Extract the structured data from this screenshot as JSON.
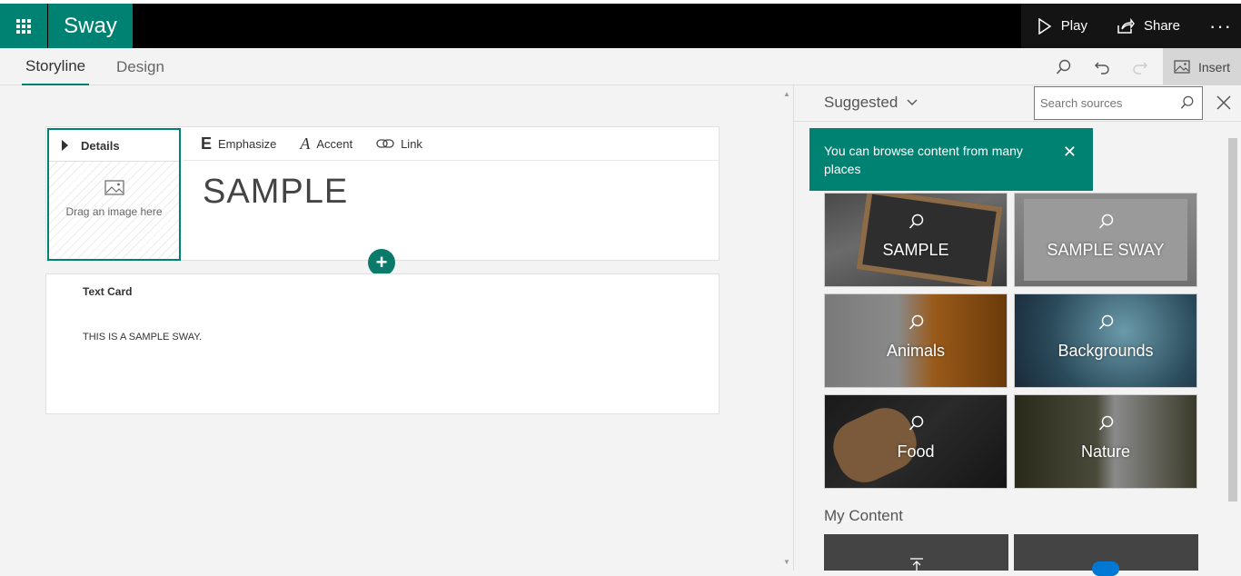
{
  "app": {
    "name": "Sway"
  },
  "topbar": {
    "play_label": "Play",
    "share_label": "Share",
    "more_label": "···"
  },
  "tabs": {
    "storyline": "Storyline",
    "design": "Design"
  },
  "toolbar": {
    "insert_label": "Insert"
  },
  "card1": {
    "details_label": "Details",
    "drop_text": "Drag an image here",
    "emphasize_label": "Emphasize",
    "emphasize_glyph": "E",
    "accent_label": "Accent",
    "accent_glyph": "A",
    "link_label": "Link",
    "title": "SAMPLE"
  },
  "add_button": "+",
  "card2": {
    "label": "Text Card",
    "body": "THIS IS A SAMPLE SWAY."
  },
  "panel": {
    "source_label": "Suggested",
    "search_placeholder": "Search sources",
    "tooltip": "You can browse content from many places",
    "tooltip_close": "✕",
    "tiles": [
      "SAMPLE",
      "SAMPLE SWAY",
      "Animals",
      "Backgrounds",
      "Food",
      "Nature"
    ],
    "my_content_label": "My Content"
  },
  "colors": {
    "accent": "#008272",
    "topbar": "#000000"
  },
  "icons": [
    "waffle-icon",
    "play-icon",
    "share-icon",
    "search-icon",
    "undo-icon",
    "redo-icon",
    "image-icon",
    "link-icon",
    "close-icon",
    "chevron-down-icon"
  ]
}
